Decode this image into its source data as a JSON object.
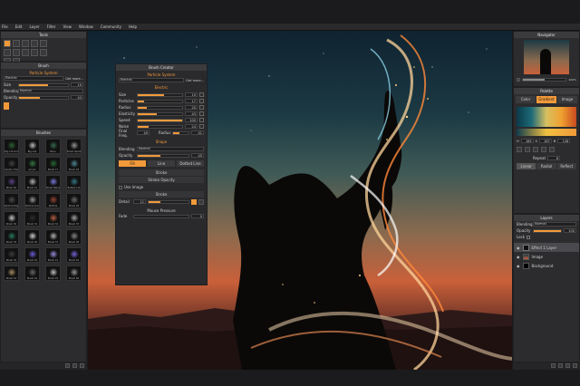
{
  "menu": [
    "File",
    "Edit",
    "Layer",
    "Filter",
    "View",
    "Window",
    "Community",
    "Help"
  ],
  "tools_panel": {
    "title": "Tools"
  },
  "brush_panel": {
    "title": "Brush",
    "subtitle": "Particle System",
    "preset": "Electric",
    "get_more": "Get more...",
    "size_label": "Size",
    "size_value": "19",
    "blending_label": "Blending",
    "blending_value": "Normal",
    "opacity_label": "Opacity",
    "opacity_value": "43"
  },
  "brushes_panel": {
    "title": "Brushes",
    "items": [
      "Big Cut Out",
      "Big Cell",
      "Bone",
      "Brush Sparkle",
      "Caustic Hole",
      "Acrylic",
      "Brush 17",
      "Brush 18",
      "Brush 20",
      "Brush 21",
      "Brush Name",
      "Bubble Cut",
      "Particle Bright",
      "Particle Dust",
      "Particle",
      "Brush 28",
      "Brush 30",
      "Brush 31",
      "Brush 32",
      "Brush 33",
      "Brush 35",
      "Brush 36",
      "Brush 37",
      "Brush 38",
      "Brush 39",
      "Brush 40",
      "Brush 41",
      "Brush 42",
      "Brush 43",
      "Brush 44",
      "Brush 45",
      "Brush 46"
    ]
  },
  "brush_creator": {
    "title": "Brush Creator",
    "subtitle": "Particle System",
    "preset": "Electric",
    "get_more": "Get more...",
    "section_electric": "Electric",
    "params": [
      {
        "label": "Size",
        "value": "19",
        "fill": 0.6
      },
      {
        "label": "Particles",
        "value": "17",
        "fill": 0.15
      },
      {
        "label": "Radius",
        "value": "20",
        "fill": 0.2
      },
      {
        "label": "Elasticity",
        "value": "43",
        "fill": 0.43
      },
      {
        "label": "Speed",
        "value": "100",
        "fill": 1.0
      },
      {
        "label": "Noise",
        "value": "24",
        "fill": 0.24
      }
    ],
    "final_freq_label": "Final Freq.",
    "final_freq_value": "49",
    "radius_label": "Radius",
    "radius_value": "41",
    "section_shape": "Shape",
    "blending_label": "Blending",
    "blending_value": "Normal",
    "opacity_label": "Opacity",
    "opacity_value": "45",
    "stroke_tabs": [
      "Fill",
      "Line",
      "Dotted Line"
    ],
    "stroke_heading": "Stroke",
    "stroke_opacity_heading": "Stroke Opacity",
    "use_image_label": "Use Image",
    "stroke_heading2": "Stroke",
    "detail_label": "Detail",
    "detail_value": "11",
    "mouse_pressure_heading": "Mouse Pressure",
    "fade_label": "Fade",
    "fade_value": "0"
  },
  "navigator": {
    "title": "Navigator",
    "zoom": "100%"
  },
  "palette": {
    "title": "Palette",
    "tabs": [
      "Color",
      "Gradient",
      "Image"
    ],
    "h_label": "H",
    "h_value": "165",
    "s_label": "S",
    "s_value": "187",
    "b_label": "B",
    "b_value": "128",
    "repeat_label": "Repeat",
    "repeat_value": "8",
    "mode_buttons": [
      "Linear",
      "Radial",
      "Reflect"
    ]
  },
  "layers": {
    "title": "Layers",
    "blending_label": "Blending",
    "blending_value": "Normal",
    "opacity_label": "Opacity",
    "opacity_value": "100",
    "lock_label": "Lock",
    "items": [
      "Effect 1 Layer",
      "Image",
      "Background"
    ]
  },
  "colors": {
    "accent": "#f29a3a",
    "panel": "#2c2c2e",
    "header": "#3b3b3e"
  }
}
